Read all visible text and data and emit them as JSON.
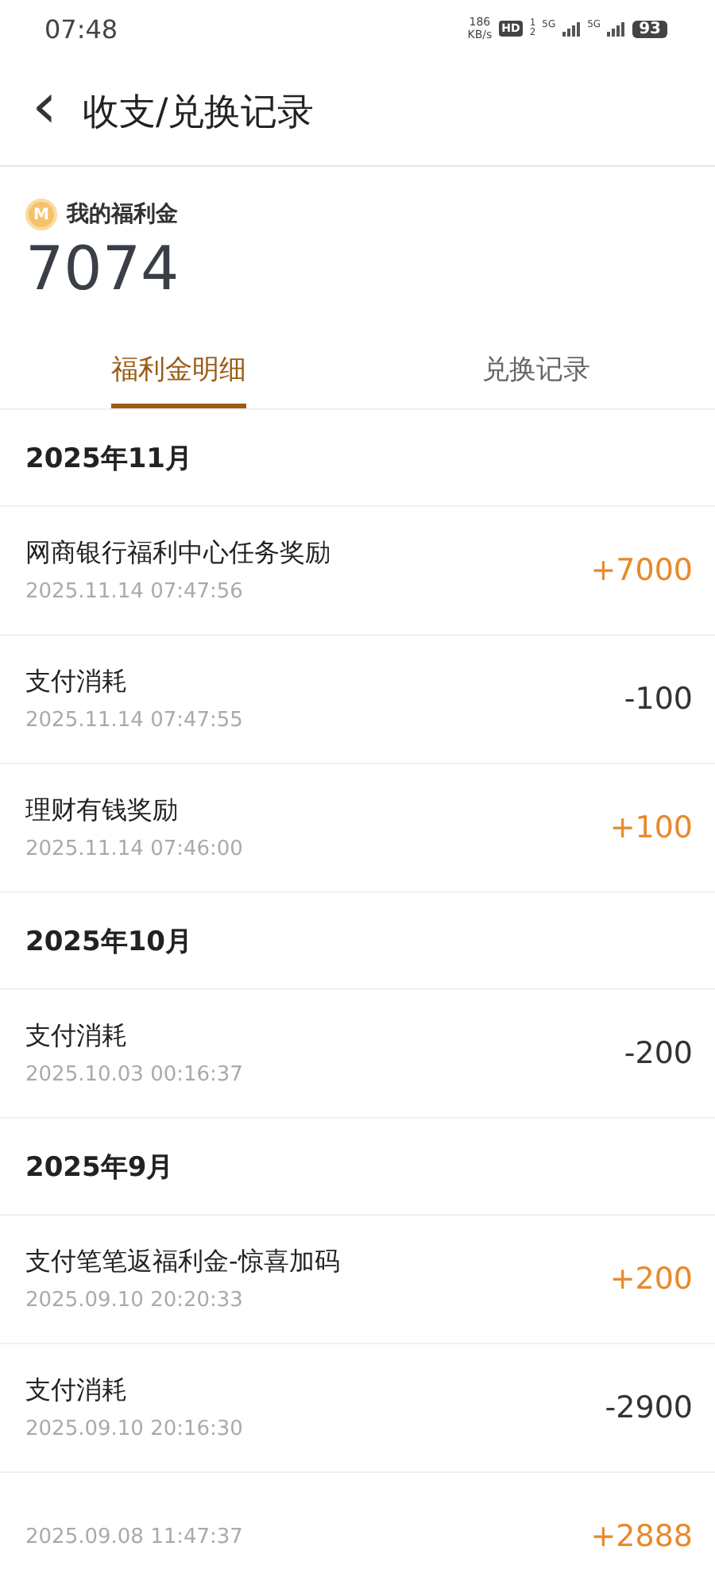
{
  "status_bar": {
    "time": "07:48",
    "speed": "186",
    "speed_unit": "KB/s",
    "hd": "HD",
    "sim": "1\n2",
    "network_1": "5G",
    "network_2": "5G",
    "battery": "93"
  },
  "header": {
    "back": "‹",
    "title": "收支/兑换记录"
  },
  "balance": {
    "label": "我的福利金",
    "coin": "M",
    "amount": "7074"
  },
  "tabs": [
    {
      "label": "福利金明细",
      "selected": true
    },
    {
      "label": "兑换记录",
      "selected": false
    }
  ],
  "groups": [
    {
      "month": "2025年11月",
      "records": [
        {
          "title": "网商银行福利中心任务奖励",
          "time": "2025.11.14 07:47:56",
          "amount": "+7000",
          "kind": "income"
        },
        {
          "title": "支付消耗",
          "time": "2025.11.14 07:47:55",
          "amount": "-100",
          "kind": "expense"
        },
        {
          "title": "理财有钱奖励",
          "time": "2025.11.14 07:46:00",
          "amount": "+100",
          "kind": "income"
        }
      ]
    },
    {
      "month": "2025年10月",
      "records": [
        {
          "title": "支付消耗",
          "time": "2025.10.03 00:16:37",
          "amount": "-200",
          "kind": "expense"
        }
      ]
    },
    {
      "month": "2025年9月",
      "records": [
        {
          "title": "支付笔笔返福利金-惊喜加码",
          "time": "2025.09.10 20:20:33",
          "amount": "+200",
          "kind": "income"
        },
        {
          "title": "支付消耗",
          "time": "2025.09.10 20:16:30",
          "amount": "-2900",
          "kind": "expense"
        },
        {
          "time": "2025.09.08 11:47:37",
          "amount": "+2888",
          "kind": "income"
        }
      ]
    }
  ]
}
